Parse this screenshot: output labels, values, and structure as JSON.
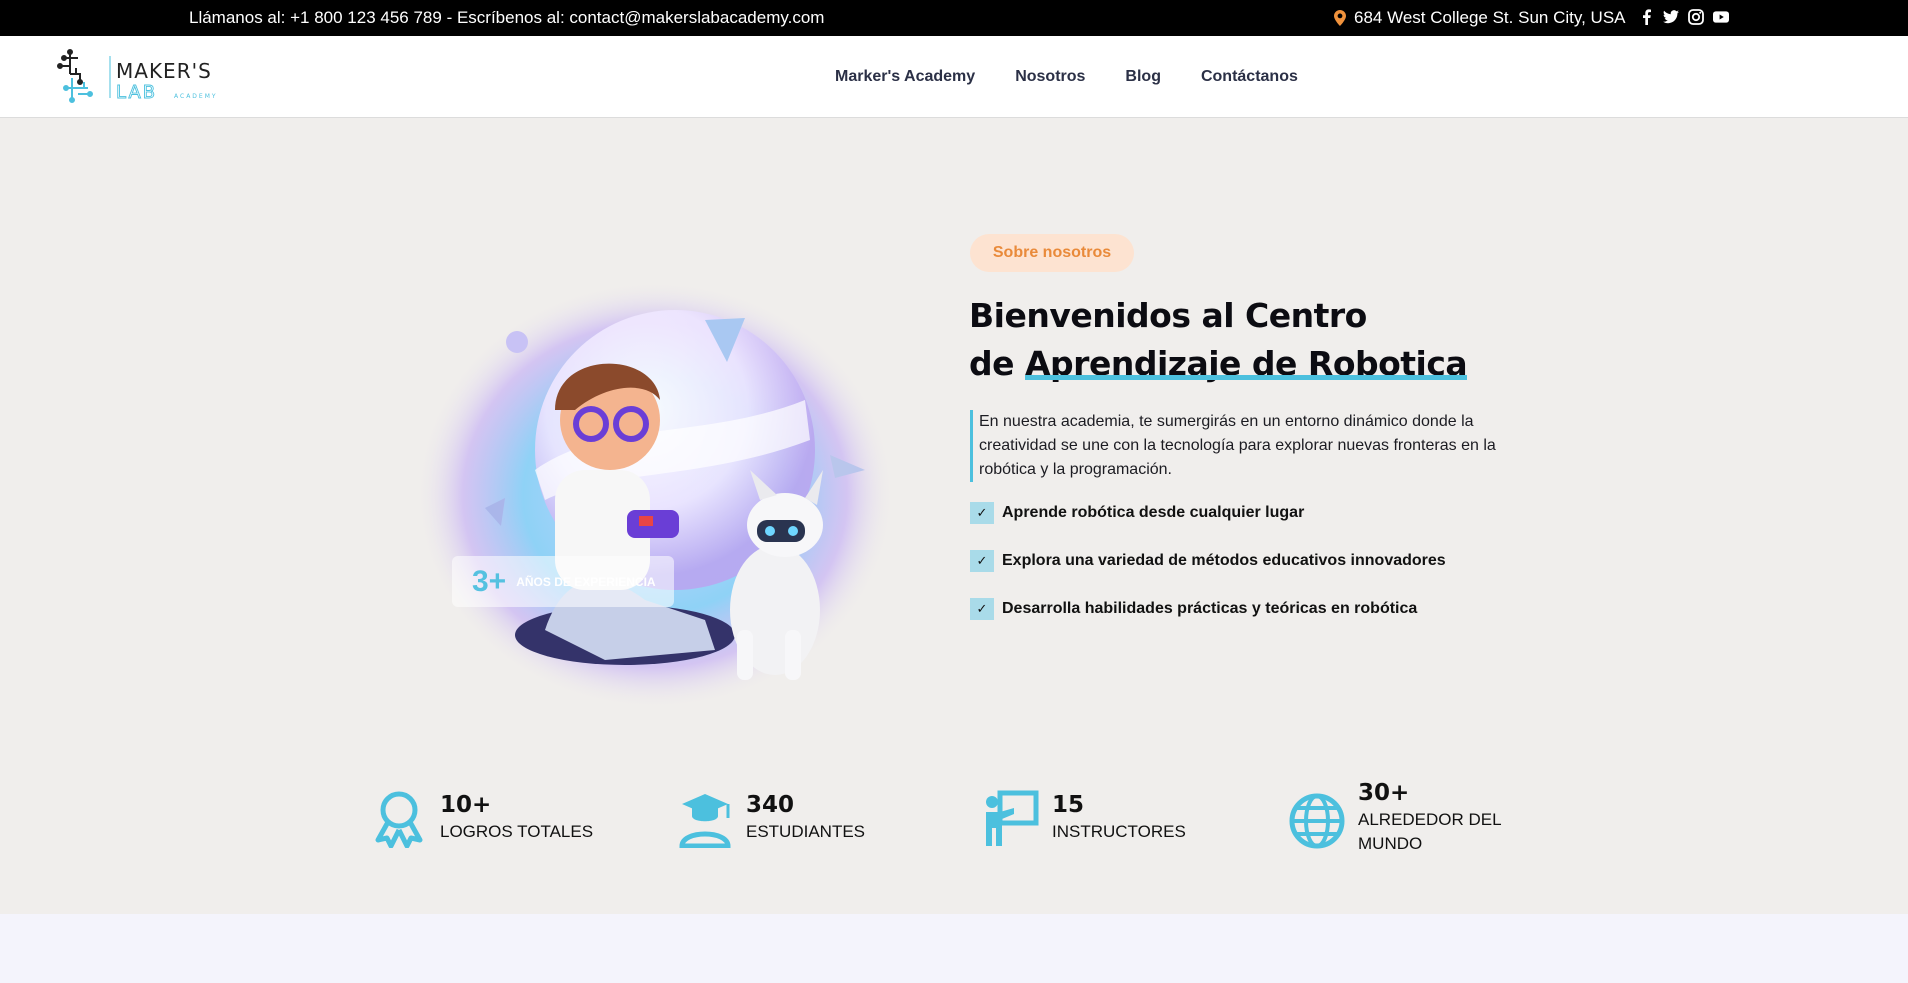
{
  "topbar": {
    "contact": "Llámanos al: +1 800 123 456 789 - Escríbenos al: contact@makerslabacademy.com",
    "address": "684 West College St. Sun City, USA",
    "socials": [
      "facebook-icon",
      "twitter-icon",
      "instagram-icon",
      "youtube-icon"
    ]
  },
  "header": {
    "logo_text": "MAKER'S LAB ACADEMY",
    "nav": [
      "Marker's Academy",
      "Nosotros",
      "Blog",
      "Contáctanos"
    ]
  },
  "hero": {
    "experience_number": "3+",
    "experience_label": "AÑOS DE EXPERIENCIA",
    "tag": "Sobre nosotros",
    "title_line1": "Bienvenidos al Centro",
    "title_line2_prefix": "de",
    "title_line2_highlight": "Aprendizaje de Robotica",
    "description": "En nuestra academia, te sumergirás en un entorno dinámico donde la creatividad se une con la tecnología para explorar nuevas fronteras en la robótica y la programación.",
    "checks": [
      "Aprende robótica desde cualquier lugar",
      "Explora una variedad de métodos educativos innovadores",
      "Desarrolla habilidades prácticas y teóricas en robótica"
    ]
  },
  "stats": [
    {
      "number": "10+",
      "label": "LOGROS TOTALES",
      "icon": "award-icon"
    },
    {
      "number": "340",
      "label": "ESTUDIANTES",
      "icon": "graduate-icon"
    },
    {
      "number": "15",
      "label": "INSTRUCTORES",
      "icon": "instructor-icon"
    },
    {
      "number": "30+",
      "label": "ALREDEDOR DEL MUNDO",
      "icon": "globe-icon"
    }
  ],
  "colors": {
    "accent": "#4cc0de",
    "orange": "#e98a3a",
    "pill_bg": "#fde3d1",
    "nav": "#2b3046"
  }
}
